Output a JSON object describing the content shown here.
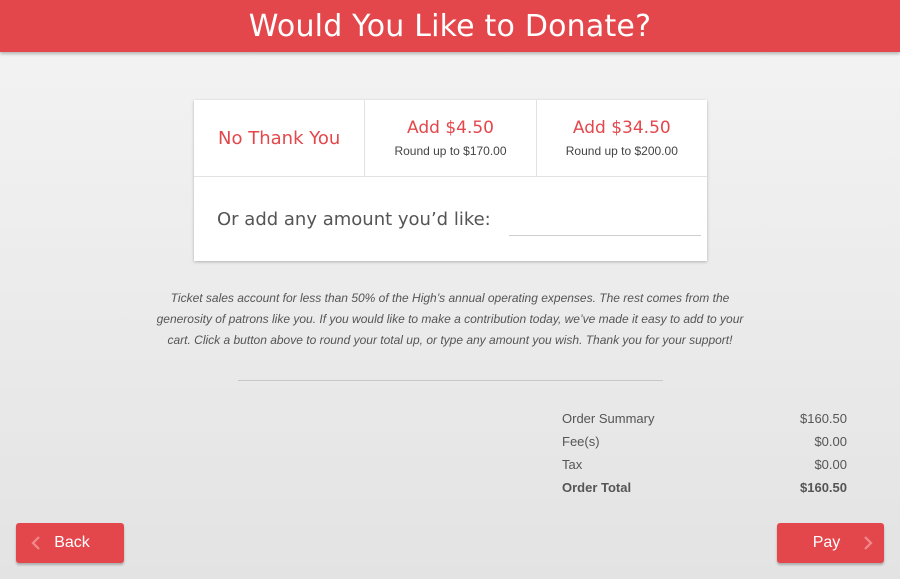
{
  "header": {
    "title": "Would You Like to Donate?"
  },
  "options": [
    {
      "main": "No Thank You",
      "sub": ""
    },
    {
      "main": "Add $4.50",
      "sub": "Round up to $170.00"
    },
    {
      "main": "Add $34.50",
      "sub": "Round up to $200.00"
    }
  ],
  "custom": {
    "label": "Or add any amount you’d like:",
    "value": "",
    "placeholder": ""
  },
  "blurb": "Ticket sales account for less than 50% of the High’s annual operating expenses. The rest comes from the generosity of patrons like you. If you would like to make a contribution today, we’ve made it easy to add to your cart. Click a button above to round your total up, or type any amount you wish. Thank you for your support!",
  "summary": [
    {
      "label": "Order Summary",
      "value": "$160.50"
    },
    {
      "label": "Fee(s)",
      "value": "$0.00"
    },
    {
      "label": "Tax",
      "value": "$0.00"
    },
    {
      "label": "Order Total",
      "value": "$160.50"
    }
  ],
  "buttons": {
    "back": "Back",
    "pay": "Pay"
  },
  "icons": {
    "back": "chevron-left-icon",
    "pay": "chevron-right-icon"
  },
  "colors": {
    "accent": "#e4474b",
    "chevron": "#ee8a8c"
  }
}
